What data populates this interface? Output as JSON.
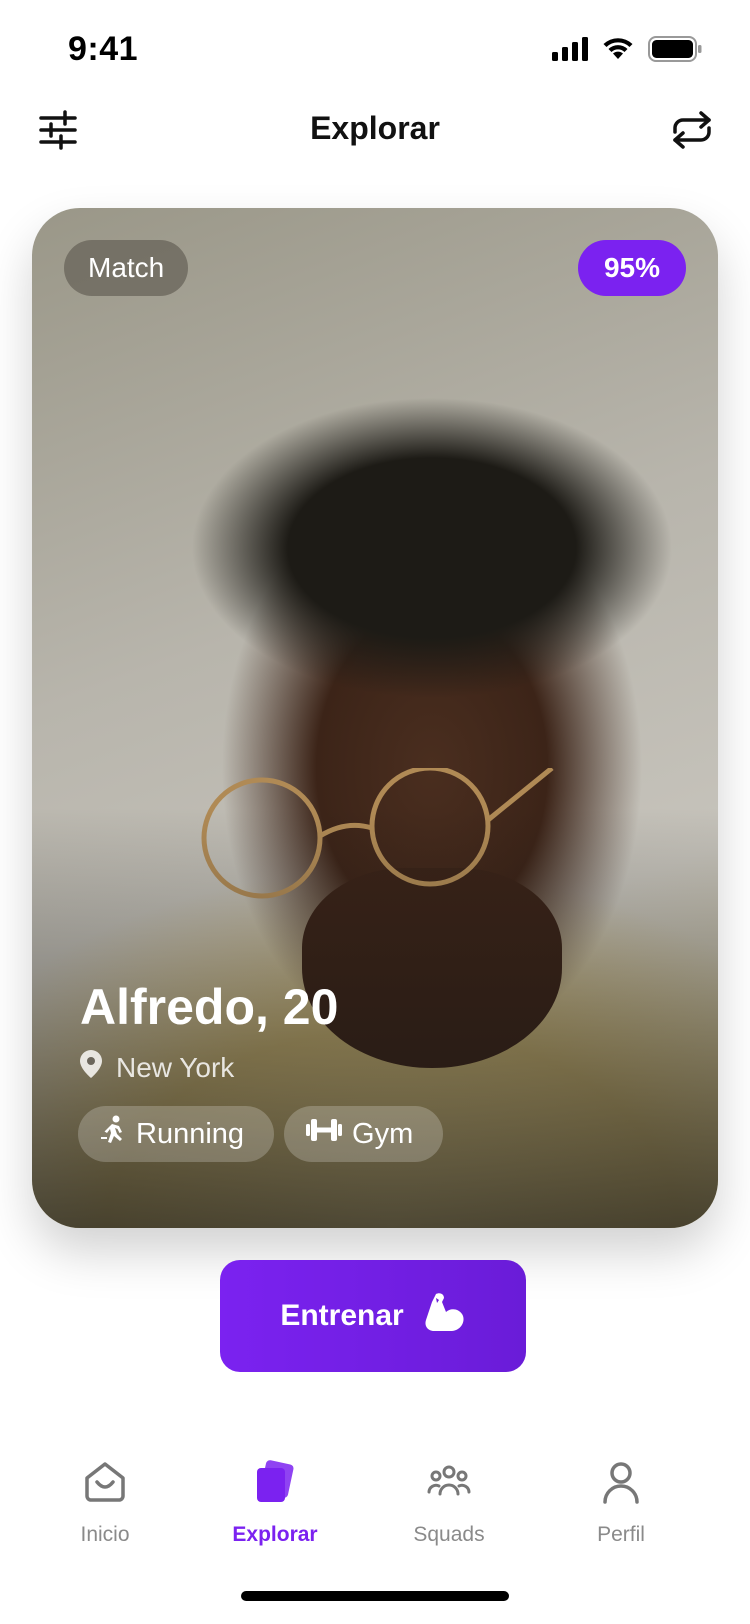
{
  "status_bar": {
    "time": "9:41"
  },
  "header": {
    "title": "Explorar"
  },
  "card": {
    "match_label": "Match",
    "match_percent": "95%",
    "name": "Alfredo, 20",
    "location": "New York",
    "tags": [
      {
        "label": "Running",
        "icon": "running-icon"
      },
      {
        "label": "Gym",
        "icon": "dumbbell-icon"
      }
    ]
  },
  "cta": {
    "label": "Entrenar",
    "icon": "flexed-bicep-icon"
  },
  "nav": {
    "items": [
      {
        "label": "Inicio",
        "icon": "home-icon",
        "active": false
      },
      {
        "label": "Explorar",
        "icon": "cards-icon",
        "active": true
      },
      {
        "label": "Squads",
        "icon": "group-icon",
        "active": false
      },
      {
        "label": "Perfil",
        "icon": "user-icon",
        "active": false
      }
    ]
  },
  "colors": {
    "accent": "#7b22f0",
    "inactive": "#8a8a8a"
  }
}
